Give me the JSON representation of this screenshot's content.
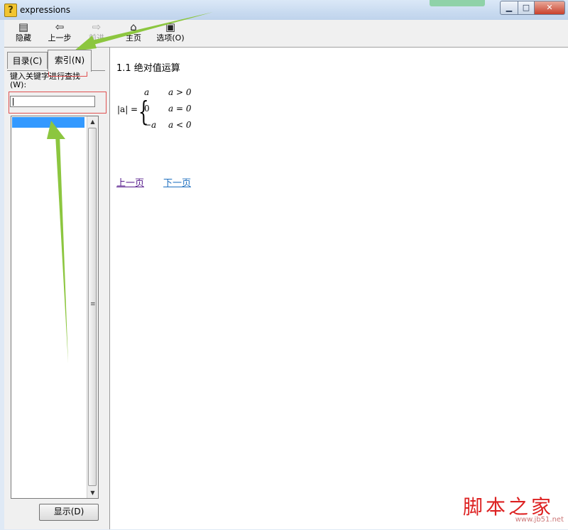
{
  "window": {
    "title": "expressions",
    "min_glyph": "▁",
    "max_glyph": "□",
    "close_glyph": "✕"
  },
  "toolbar": {
    "hide_label": "隐藏",
    "back_label": "上一步",
    "forward_label": "前进",
    "home_label": "主页",
    "options_label": "选项(O)"
  },
  "sidebar": {
    "tabs": [
      {
        "label": "目录(C)"
      },
      {
        "label": "索引(N)"
      }
    ],
    "keyword_label": "键入关键字进行查找(W):",
    "search_value": "",
    "display_button": "显示(D)"
  },
  "content": {
    "heading": "1.1 绝对值运算",
    "formula": {
      "lhs": "|a| =",
      "cases": [
        {
          "value": "a",
          "condition": "a > 0"
        },
        {
          "value": "0",
          "condition": "a = 0"
        },
        {
          "value": "−a",
          "condition": "a < 0"
        }
      ]
    },
    "prev_link": "上一页",
    "next_link": "下一页"
  },
  "watermark": {
    "text": "脚本之家",
    "url": "www.jb51.net"
  },
  "colors": {
    "selection": "#3399ff",
    "annotation_red": "#e05050",
    "annotation_arrow": "#8cc63f",
    "visited_link": "#551a8b",
    "link": "#1e6fbf"
  }
}
